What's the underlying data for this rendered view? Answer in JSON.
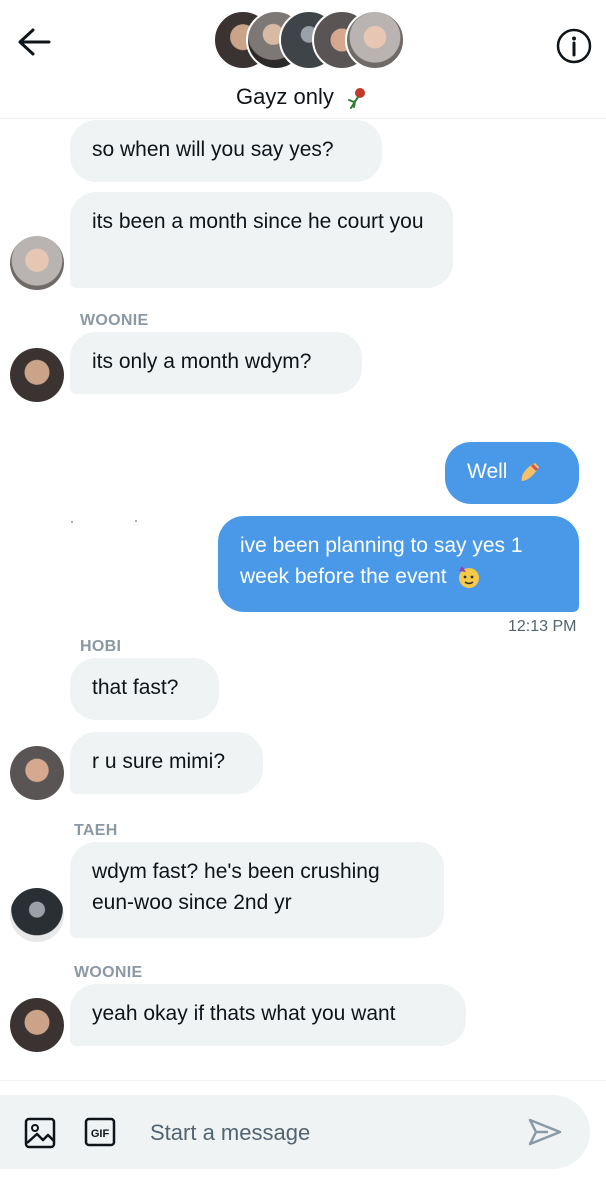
{
  "header": {
    "title": "Gayz only",
    "back_icon": "arrow-left-icon",
    "info_icon": "info-circle-icon",
    "title_icon": "rose-icon"
  },
  "messages": [
    {
      "side": "left",
      "text": "so when will you say yes?"
    },
    {
      "side": "left",
      "text": "its been a month since he court you"
    },
    {
      "side": "left",
      "sender": "WOONIE",
      "text": "its only a month wdym?"
    },
    {
      "side": "right",
      "text": "Well",
      "emoji": "nail-polish"
    },
    {
      "side": "right",
      "text": "ive been planning to say yes 1 week before the event",
      "emoji": "partying-face",
      "time": "12:13 PM"
    },
    {
      "side": "left",
      "sender": "HOBI",
      "text": "that fast?"
    },
    {
      "side": "left",
      "text": "r u sure mimi?"
    },
    {
      "side": "left",
      "sender": "TAEH",
      "text": "wdym fast? he's been crushing eun-woo since 2nd yr"
    },
    {
      "side": "left",
      "sender": "WOONIE",
      "text": "yeah  okay if thats what you want"
    }
  ],
  "composer": {
    "placeholder": "Start a message",
    "gif_label": "GIF",
    "image_icon": "image-icon",
    "send_icon": "send-icon"
  },
  "colors": {
    "accent": "#4a99e9",
    "bubble_gray": "#eff3f4",
    "secondary_text": "#536471"
  }
}
